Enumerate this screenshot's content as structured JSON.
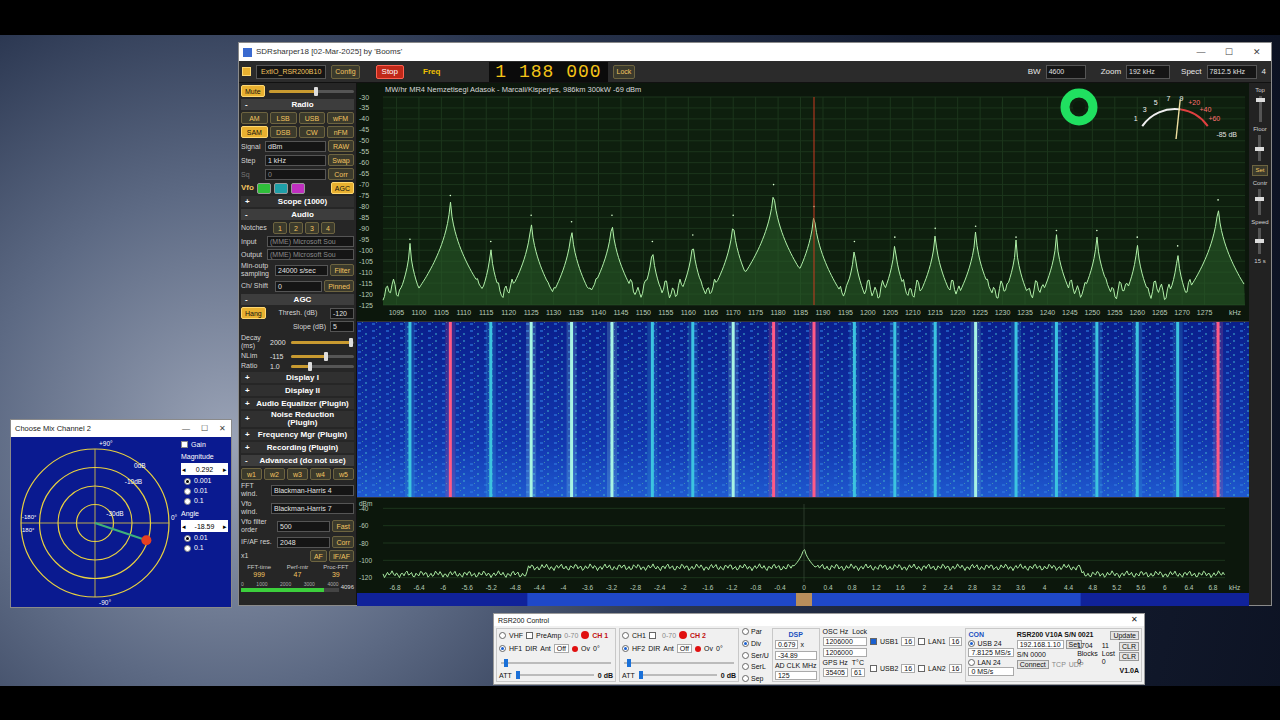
{
  "mainWindow": {
    "title": "SDRsharper18 [02-Mar-2025] by 'Booms'",
    "controls": [
      "—",
      "☐",
      "✕"
    ]
  },
  "toolbar": {
    "enabled": true,
    "source": "ExtIO_RSR200B10",
    "config": "Config",
    "stop": "Stop",
    "freqLabel": "Freq",
    "frequency": "1 188 000",
    "lock": "Lock",
    "bwLabel": "BW",
    "bw": "4600",
    "zoomLabel": "Zoom",
    "zoom": "192 kHz",
    "spectLabel": "Spect",
    "spect": "7812.5 kHz",
    "spectNum": "4"
  },
  "leftPanel": {
    "mute": {
      "label": "Mute",
      "on": true,
      "volume": 0.55
    },
    "radio": {
      "title": "Radio",
      "sign": "-",
      "expanded": true,
      "modes": [
        {
          "label": "AM",
          "selected": false
        },
        {
          "label": "LSB",
          "selected": false
        },
        {
          "label": "USB",
          "selected": false
        },
        {
          "label": "wFM",
          "selected": false
        },
        {
          "label": "SAM",
          "selected": true
        },
        {
          "label": "DSB",
          "selected": false
        },
        {
          "label": "CW",
          "selected": false
        },
        {
          "label": "nFM",
          "selected": false
        }
      ],
      "rows": [
        {
          "label": "Signal",
          "value": "dBm",
          "button": "RAW",
          "disabled": false
        },
        {
          "label": "Step",
          "value": "1 kHz",
          "button": "Swap",
          "disabled": false
        },
        {
          "label": "Sq",
          "value": "0",
          "button": "Corr",
          "disabled": true
        }
      ],
      "vfo": {
        "label": "Vfo",
        "buttons": [
          {
            "color": "#2fbf3a"
          },
          {
            "color": "#1f9fa8"
          },
          {
            "color": "#c02fc0"
          }
        ],
        "agc": "AGC",
        "agcOn": true
      }
    },
    "scope": {
      "title": "Scope (1000)",
      "sign": "+",
      "expanded": false
    },
    "audio": {
      "title": "Audio",
      "sign": "-",
      "expanded": true,
      "notches": {
        "label": "Notches",
        "buttons": [
          "1",
          "2",
          "3",
          "4"
        ]
      },
      "fields": [
        {
          "label": "Input",
          "value": "(MME) Microsoft Sou",
          "disabled": true
        },
        {
          "label": "Output",
          "value": "(MME) Microsoft Sou",
          "disabled": true
        }
      ],
      "sampling": {
        "label": "Min-outp sampling",
        "value": "24000 s/sec",
        "button": "Filter"
      },
      "shift": {
        "label": "Ch/ Shift",
        "value": "0",
        "button": "Pinned"
      }
    },
    "agc": {
      "title": "AGC",
      "sign": "-",
      "expanded": true,
      "hang": {
        "label": "Hang",
        "on": true
      },
      "rows": [
        {
          "label": "Thresh. (dB)",
          "value": "-120"
        },
        {
          "label": "Slope (dB)",
          "value": "5"
        }
      ],
      "decay": {
        "label": "Decay (ms)",
        "value": "2000",
        "level": 0.95
      },
      "nlim": {
        "label": "NLim",
        "value": "-115",
        "level": 0.55
      },
      "ratio": {
        "label": "Ratio",
        "value": "1.0",
        "level": 0.3
      }
    },
    "sections": [
      {
        "title": "Display I",
        "sign": "+",
        "expanded": false
      },
      {
        "title": "Display II",
        "sign": "+",
        "expanded": false
      },
      {
        "title": "Audio Equalizer (Plugin)",
        "sign": "+",
        "expanded": false
      },
      {
        "title": "Noise Reduction (Plugin)",
        "sign": "+",
        "expanded": false
      },
      {
        "title": "Frequency Mgr (Plugin)",
        "sign": "+",
        "expanded": false
      },
      {
        "title": "Recording (Plugin)",
        "sign": "+",
        "expanded": false
      },
      {
        "title": "Advanced (do not use)",
        "sign": "-",
        "expanded": true
      }
    ],
    "advanced": {
      "windows": [
        "w1",
        "w2",
        "w3",
        "w4",
        "w5"
      ],
      "fields": [
        {
          "label": "FFT wind.",
          "value": "Blackman-Harris 4"
        },
        {
          "label": "Vfo wind.",
          "value": "Blackman-Harris 7"
        }
      ],
      "filterOrder": {
        "label": "Vfo filter order",
        "value": "500",
        "button": "Fast"
      },
      "ifaf": {
        "label": "IF/AF res.",
        "value": "2048",
        "button": "Corr"
      },
      "zoom": {
        "label": "x1",
        "buttons": [
          "AF",
          "IF/AF"
        ]
      },
      "stats": [
        {
          "label": "FFT-time",
          "value": "999"
        },
        {
          "label": "Perf-mtr",
          "value": "47"
        },
        {
          "label": "Proc-FFT",
          "value": "39"
        }
      ],
      "bar": {
        "ticks": [
          "0",
          "1000",
          "2000",
          "3000",
          "4000"
        ],
        "value": "4096",
        "level": 0.85
      }
    }
  },
  "spectrum": {
    "station": "MW/hr MR4 Nemzetisegi Adasok - Marcali/Kisperjes, 986km 300kW -69 dBm",
    "yTicks": [
      "-30",
      "-35",
      "-40",
      "-45",
      "-50",
      "-55",
      "-60",
      "-65",
      "-70",
      "-75",
      "-80",
      "-85",
      "-90",
      "-95",
      "-100",
      "-105",
      "-110",
      "-115",
      "-120",
      "-125"
    ],
    "xTicks": [
      "1095",
      "1100",
      "1105",
      "1110",
      "1115",
      "1120",
      "1125",
      "1130",
      "1135",
      "1140",
      "1145",
      "1150",
      "1155",
      "1160",
      "1165",
      "1170",
      "1175",
      "1180",
      "1185",
      "1190",
      "1195",
      "1200",
      "1205",
      "1210",
      "1215",
      "1220",
      "1225",
      "1230",
      "1235",
      "1240",
      "1245",
      "1250",
      "1255",
      "1260",
      "1265",
      "1270",
      "1275"
    ],
    "unit": "kHz",
    "centerFreq": 1188,
    "spanStart": 1092,
    "spanEnd": 1284,
    "floor": -118,
    "dbTop": -30,
    "dbBottom": -125,
    "carriers": [
      {
        "freq": 1098,
        "level": -95
      },
      {
        "freq": 1107,
        "level": -75
      },
      {
        "freq": 1116,
        "level": -96
      },
      {
        "freq": 1125,
        "level": -84
      },
      {
        "freq": 1134,
        "level": -87
      },
      {
        "freq": 1143,
        "level": -84
      },
      {
        "freq": 1152,
        "level": -96
      },
      {
        "freq": 1161,
        "level": -93
      },
      {
        "freq": 1170,
        "level": -84
      },
      {
        "freq": 1179,
        "level": -70
      },
      {
        "freq": 1188,
        "level": -80
      },
      {
        "freq": 1197,
        "level": -96
      },
      {
        "freq": 1206,
        "level": -94
      },
      {
        "freq": 1215,
        "level": -90
      },
      {
        "freq": 1224,
        "level": -89
      },
      {
        "freq": 1233,
        "level": -94
      },
      {
        "freq": 1242,
        "level": -91
      },
      {
        "freq": 1251,
        "level": -91
      },
      {
        "freq": 1260,
        "level": -94
      },
      {
        "freq": 1269,
        "level": -98
      },
      {
        "freq": 1278,
        "level": -77
      }
    ]
  },
  "audio": {
    "yUnit": "dBm",
    "yTicks": [
      "-40",
      "-60",
      "-80",
      "-100",
      "-120"
    ],
    "xTicks": [
      "-6.8",
      "-6.4",
      "-6",
      "-5.6",
      "-5.2",
      "-4.8",
      "-4.4",
      "-4",
      "-3.6",
      "-3.2",
      "-2.8",
      "-2.4",
      "-2",
      "-1.6",
      "-1.2",
      "-0.8",
      "-0.4",
      "0",
      "0.4",
      "0.8",
      "1.2",
      "1.6",
      "2",
      "2.4",
      "2.8",
      "3.2",
      "3.6",
      "4",
      "4.4",
      "4.8",
      "5.2",
      "5.6",
      "6",
      "6.4",
      "6.8"
    ],
    "unit": "kHz",
    "span": 7,
    "floor": -108,
    "floorOutside": -116,
    "peak": -82,
    "dbTop": -35,
    "dbBottom": -125
  },
  "sideControls": [
    {
      "kind": "slider",
      "label": "Top",
      "level": 0.85
    },
    {
      "kind": "slider",
      "label": "Floor",
      "level": 0.45
    },
    {
      "kind": "button",
      "label": "Set"
    },
    {
      "kind": "slider",
      "label": "Contr",
      "level": 0.6
    },
    {
      "kind": "slider",
      "label": "Speed",
      "level": 0.5
    },
    {
      "kind": "reading",
      "label": "15 s"
    }
  ],
  "smeter": {
    "scale": [
      "1",
      "3",
      "5",
      "7",
      "9",
      "+20",
      "+40",
      "+60"
    ],
    "reading": "-85 dB",
    "level": 0.55
  },
  "mixWindow": {
    "title": "Choose Mix Channel 2",
    "controls": [
      "—",
      "☐",
      "✕"
    ],
    "spinDown": "◂",
    "spinUp": "▸",
    "gain": {
      "label": "Gain",
      "checked": false
    },
    "magnitude": {
      "label": "Magnitude",
      "value": "0.292",
      "steps": [
        {
          "label": "0.001",
          "selected": true
        },
        {
          "label": "0.01",
          "selected": false
        },
        {
          "label": "0.1",
          "selected": false
        }
      ]
    },
    "angle": {
      "label": "Angle",
      "value": "-18.59",
      "steps": [
        {
          "label": "0.01",
          "selected": true
        },
        {
          "label": "0.1",
          "selected": false
        }
      ]
    },
    "polar": {
      "top": "+90°",
      "bottom": "-90°",
      "right": "0°",
      "leftTop": "-180°",
      "leftBottom": "180°",
      "rings": [
        0,
        -10,
        -20,
        -30
      ],
      "ringLabels": [
        {
          "label": "0dB",
          "db": 0
        },
        {
          "label": "-10dB",
          "db": -10
        },
        {
          "label": "-30dB",
          "db": -30
        }
      ]
    }
  },
  "controlWindow": {
    "title": "RSR200 Control",
    "close": "✕",
    "channels": [
      {
        "band": "VHF",
        "bandSelected": false,
        "preamp": "PreAmp",
        "preampChecked": false,
        "range": "0-70",
        "name": "CH 1",
        "overload": true,
        "hf": "HF1",
        "hfSelected": true,
        "dir": "DIR",
        "ant": "Ant",
        "antValue": "Off",
        "ov": "Ov",
        "phase": "0°",
        "gainLevel": 0.03,
        "att": "ATT",
        "attValue": "0 dB",
        "attLevel": 0.0
      },
      {
        "band": "CH1",
        "bandSelected": false,
        "preamp": "",
        "preampChecked": false,
        "range": "0-70",
        "name": "CH 2",
        "overload": true,
        "hf": "HF2",
        "hfSelected": true,
        "dir": "DIR",
        "ant": "Ant",
        "antValue": "Off",
        "ov": "Ov",
        "phase": "0°",
        "gainLevel": 0.03,
        "att": "ATT",
        "attValue": "0 dB",
        "attLevel": 0.0
      }
    ],
    "modes": [
      {
        "label": "Par",
        "selected": false
      },
      {
        "label": "Div",
        "selected": true
      },
      {
        "label": "Ser/U",
        "selected": false
      },
      {
        "label": "SerL",
        "selected": false
      },
      {
        "label": "Sep",
        "selected": false
      }
    ],
    "dsp": {
      "title": "DSP",
      "gain": "0.679",
      "x": "x",
      "phase": "-34.89",
      "clkLabel": "AD CLK MHz",
      "clk": "125"
    },
    "osc": {
      "label": "OSC Hz",
      "lock": "Lock",
      "values": [
        "1206000",
        "1206000"
      ],
      "gpsLabel": "GPS Hz",
      "tempLabel": "T°C",
      "gps": "35405",
      "temp": "61"
    },
    "links": [
      {
        "label": "USB1",
        "checked": true,
        "value": "16",
        "lan": "LAN1",
        "lanChecked": false,
        "lanValue": "16"
      },
      {
        "label": "USB2",
        "checked": false,
        "value": "16",
        "lan": "LAN2",
        "lanChecked": false,
        "lanValue": "16"
      }
    ],
    "con": {
      "title": "CON",
      "options": [
        {
          "label": "USB 24",
          "selected": true,
          "rate": "7.8125 MS/s"
        },
        {
          "label": "LAN 24",
          "selected": false,
          "rate": "0 MS/s"
        }
      ]
    },
    "device": {
      "name": "RSR200 V10A S/N 0021",
      "ip": "192.168.1.10",
      "set": "Set",
      "sn": "S/N 0000",
      "connect": "Connect",
      "tcp": "TCP",
      "udp": "UDP",
      "update": "Update",
      "blocksLabel": "Blocks",
      "blocks": "1704",
      "lostLabel": "Lost",
      "lost": "11",
      "zeros": [
        "0",
        "0"
      ],
      "clr": [
        "CLR",
        "CLR"
      ],
      "version": "V1.0A"
    }
  }
}
